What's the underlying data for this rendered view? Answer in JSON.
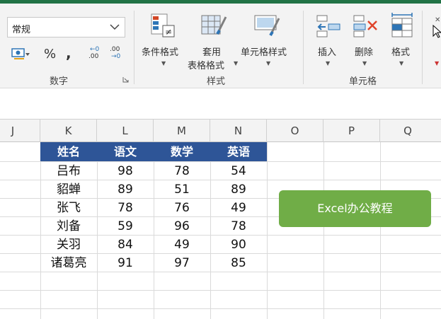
{
  "number_group": {
    "format_value": "常规",
    "percent_symbol": "%",
    "comma_symbol": ",",
    "increase_decimal_top": "←0",
    "increase_decimal_bottom": ".00",
    "decrease_decimal_top": ".00",
    "decrease_decimal_bottom": "→0",
    "label": "数字"
  },
  "styles_group": {
    "conditional_format": "条件格式",
    "format_table_line1": "套用",
    "format_table_line2": "表格格式",
    "cell_styles": "单元格样式",
    "label": "样式"
  },
  "cells_group": {
    "insert": "插入",
    "delete": "删除",
    "format": "格式",
    "label": "单元格"
  },
  "columns": [
    "J",
    "K",
    "L",
    "M",
    "N",
    "O",
    "P",
    "Q"
  ],
  "table": {
    "headers": [
      "姓名",
      "语文",
      "数学",
      "英语"
    ],
    "rows": [
      [
        "吕布",
        "98",
        "78",
        "54"
      ],
      [
        "貂蝉",
        "89",
        "51",
        "89"
      ],
      [
        "张飞",
        "78",
        "76",
        "49"
      ],
      [
        "刘备",
        "59",
        "96",
        "78"
      ],
      [
        "关羽",
        "84",
        "49",
        "90"
      ],
      [
        "诸葛亮",
        "91",
        "97",
        "85"
      ]
    ]
  },
  "overlay_button": "Excel办公教程",
  "colors": {
    "ribbon_bg": "#f3f3f3",
    "header_fill": "#2e5597",
    "button_green": "#70ad47",
    "excel_green": "#217346"
  }
}
